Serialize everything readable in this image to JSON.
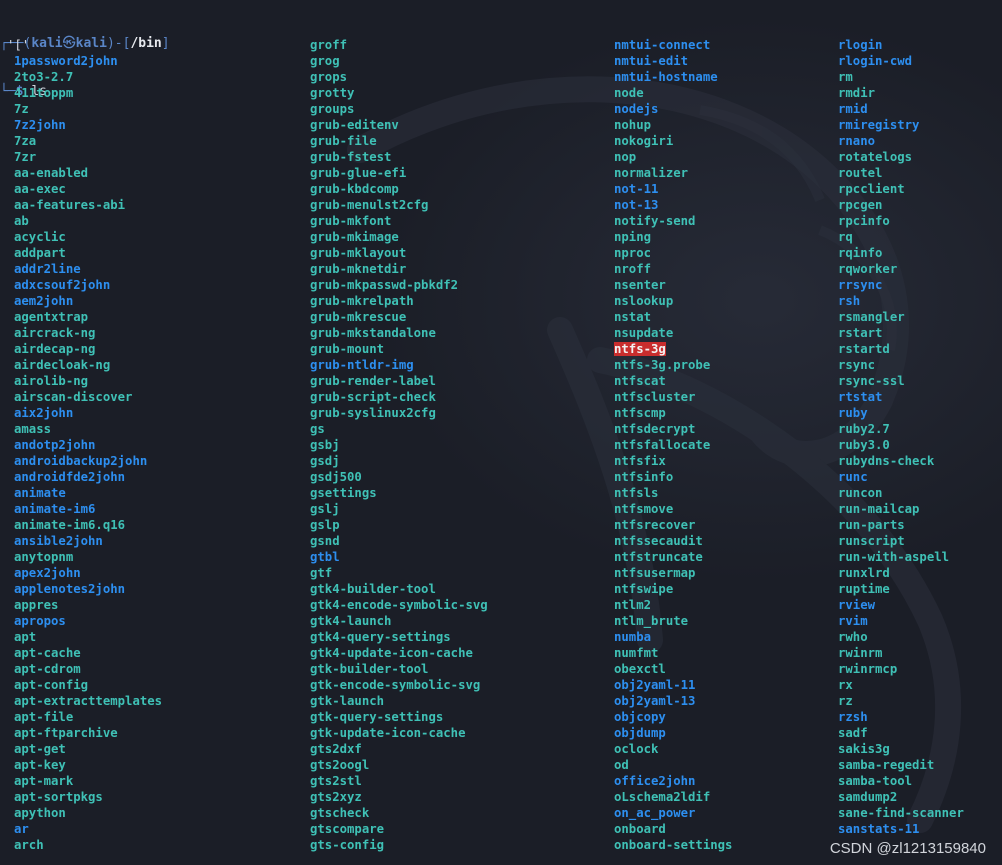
{
  "prompt": {
    "line1_open": "┌──(",
    "user": "kali",
    "at": "㉿",
    "host": "kali",
    "mid": ")-[",
    "cwd": "/bin",
    "close": "]",
    "line2_prefix": "└─",
    "dollar": "$",
    "command": "ls"
  },
  "colors": {
    "background": "#1b1e27",
    "executable": "#3fc1b6",
    "symlink": "#2d8ff0",
    "plain": "#d8dbe2",
    "highlight_bg": "#c92d2d"
  },
  "columns": [
    [
      {
        "name": "'['",
        "type": "plain"
      },
      {
        "name": "1password2john",
        "type": "link"
      },
      {
        "name": "2to3-2.7",
        "type": "exe"
      },
      {
        "name": "411toppm",
        "type": "exe"
      },
      {
        "name": "7z",
        "type": "exe"
      },
      {
        "name": "7z2john",
        "type": "link"
      },
      {
        "name": "7za",
        "type": "exe"
      },
      {
        "name": "7zr",
        "type": "exe"
      },
      {
        "name": "aa-enabled",
        "type": "exe"
      },
      {
        "name": "aa-exec",
        "type": "exe"
      },
      {
        "name": "aa-features-abi",
        "type": "exe"
      },
      {
        "name": "ab",
        "type": "exe"
      },
      {
        "name": "acyclic",
        "type": "exe"
      },
      {
        "name": "addpart",
        "type": "exe"
      },
      {
        "name": "addr2line",
        "type": "link"
      },
      {
        "name": "adxcsouf2john",
        "type": "link"
      },
      {
        "name": "aem2john",
        "type": "link"
      },
      {
        "name": "agentxtrap",
        "type": "exe"
      },
      {
        "name": "aircrack-ng",
        "type": "exe"
      },
      {
        "name": "airdecap-ng",
        "type": "exe"
      },
      {
        "name": "airdecloak-ng",
        "type": "exe"
      },
      {
        "name": "airolib-ng",
        "type": "exe"
      },
      {
        "name": "airscan-discover",
        "type": "exe"
      },
      {
        "name": "aix2john",
        "type": "link"
      },
      {
        "name": "amass",
        "type": "exe"
      },
      {
        "name": "andotp2john",
        "type": "link"
      },
      {
        "name": "androidbackup2john",
        "type": "link"
      },
      {
        "name": "androidfde2john",
        "type": "link"
      },
      {
        "name": "animate",
        "type": "link"
      },
      {
        "name": "animate-im6",
        "type": "link"
      },
      {
        "name": "animate-im6.q16",
        "type": "exe"
      },
      {
        "name": "ansible2john",
        "type": "link"
      },
      {
        "name": "anytopnm",
        "type": "exe"
      },
      {
        "name": "apex2john",
        "type": "link"
      },
      {
        "name": "applenotes2john",
        "type": "link"
      },
      {
        "name": "appres",
        "type": "exe"
      },
      {
        "name": "apropos",
        "type": "link"
      },
      {
        "name": "apt",
        "type": "exe"
      },
      {
        "name": "apt-cache",
        "type": "exe"
      },
      {
        "name": "apt-cdrom",
        "type": "exe"
      },
      {
        "name": "apt-config",
        "type": "exe"
      },
      {
        "name": "apt-extracttemplates",
        "type": "exe"
      },
      {
        "name": "apt-file",
        "type": "exe"
      },
      {
        "name": "apt-ftparchive",
        "type": "exe"
      },
      {
        "name": "apt-get",
        "type": "exe"
      },
      {
        "name": "apt-key",
        "type": "exe"
      },
      {
        "name": "apt-mark",
        "type": "exe"
      },
      {
        "name": "apt-sortpkgs",
        "type": "exe"
      },
      {
        "name": "apython",
        "type": "exe"
      },
      {
        "name": "ar",
        "type": "link"
      },
      {
        "name": "arch",
        "type": "exe"
      }
    ],
    [
      {
        "name": "groff",
        "type": "exe"
      },
      {
        "name": "grog",
        "type": "exe"
      },
      {
        "name": "grops",
        "type": "exe"
      },
      {
        "name": "grotty",
        "type": "exe"
      },
      {
        "name": "groups",
        "type": "exe"
      },
      {
        "name": "grub-editenv",
        "type": "exe"
      },
      {
        "name": "grub-file",
        "type": "exe"
      },
      {
        "name": "grub-fstest",
        "type": "exe"
      },
      {
        "name": "grub-glue-efi",
        "type": "exe"
      },
      {
        "name": "grub-kbdcomp",
        "type": "exe"
      },
      {
        "name": "grub-menulst2cfg",
        "type": "exe"
      },
      {
        "name": "grub-mkfont",
        "type": "exe"
      },
      {
        "name": "grub-mkimage",
        "type": "exe"
      },
      {
        "name": "grub-mklayout",
        "type": "exe"
      },
      {
        "name": "grub-mknetdir",
        "type": "exe"
      },
      {
        "name": "grub-mkpasswd-pbkdf2",
        "type": "exe"
      },
      {
        "name": "grub-mkrelpath",
        "type": "exe"
      },
      {
        "name": "grub-mkrescue",
        "type": "exe"
      },
      {
        "name": "grub-mkstandalone",
        "type": "exe"
      },
      {
        "name": "grub-mount",
        "type": "exe"
      },
      {
        "name": "grub-ntldr-img",
        "type": "link"
      },
      {
        "name": "grub-render-label",
        "type": "exe"
      },
      {
        "name": "grub-script-check",
        "type": "exe"
      },
      {
        "name": "grub-syslinux2cfg",
        "type": "exe"
      },
      {
        "name": "gs",
        "type": "exe"
      },
      {
        "name": "gsbj",
        "type": "exe"
      },
      {
        "name": "gsdj",
        "type": "exe"
      },
      {
        "name": "gsdj500",
        "type": "exe"
      },
      {
        "name": "gsettings",
        "type": "exe"
      },
      {
        "name": "gslj",
        "type": "exe"
      },
      {
        "name": "gslp",
        "type": "exe"
      },
      {
        "name": "gsnd",
        "type": "exe"
      },
      {
        "name": "gtbl",
        "type": "link"
      },
      {
        "name": "gtf",
        "type": "exe"
      },
      {
        "name": "gtk4-builder-tool",
        "type": "exe"
      },
      {
        "name": "gtk4-encode-symbolic-svg",
        "type": "exe"
      },
      {
        "name": "gtk4-launch",
        "type": "exe"
      },
      {
        "name": "gtk4-query-settings",
        "type": "exe"
      },
      {
        "name": "gtk4-update-icon-cache",
        "type": "exe"
      },
      {
        "name": "gtk-builder-tool",
        "type": "exe"
      },
      {
        "name": "gtk-encode-symbolic-svg",
        "type": "exe"
      },
      {
        "name": "gtk-launch",
        "type": "exe"
      },
      {
        "name": "gtk-query-settings",
        "type": "exe"
      },
      {
        "name": "gtk-update-icon-cache",
        "type": "exe"
      },
      {
        "name": "gts2dxf",
        "type": "exe"
      },
      {
        "name": "gts2oogl",
        "type": "exe"
      },
      {
        "name": "gts2stl",
        "type": "exe"
      },
      {
        "name": "gts2xyz",
        "type": "exe"
      },
      {
        "name": "gtscheck",
        "type": "exe"
      },
      {
        "name": "gtscompare",
        "type": "exe"
      },
      {
        "name": "gts-config",
        "type": "exe"
      }
    ],
    [
      {
        "name": "nmtui-connect",
        "type": "link"
      },
      {
        "name": "nmtui-edit",
        "type": "link"
      },
      {
        "name": "nmtui-hostname",
        "type": "link"
      },
      {
        "name": "node",
        "type": "exe"
      },
      {
        "name": "nodejs",
        "type": "link"
      },
      {
        "name": "nohup",
        "type": "exe"
      },
      {
        "name": "nokogiri",
        "type": "exe"
      },
      {
        "name": "nop",
        "type": "exe"
      },
      {
        "name": "normalizer",
        "type": "exe"
      },
      {
        "name": "not-11",
        "type": "link"
      },
      {
        "name": "not-13",
        "type": "link"
      },
      {
        "name": "notify-send",
        "type": "exe"
      },
      {
        "name": "nping",
        "type": "exe"
      },
      {
        "name": "nproc",
        "type": "exe"
      },
      {
        "name": "nroff",
        "type": "exe"
      },
      {
        "name": "nsenter",
        "type": "exe"
      },
      {
        "name": "nslookup",
        "type": "exe"
      },
      {
        "name": "nstat",
        "type": "exe"
      },
      {
        "name": "nsupdate",
        "type": "exe"
      },
      {
        "name": "ntfs-3g",
        "type": "hl"
      },
      {
        "name": "ntfs-3g.probe",
        "type": "exe"
      },
      {
        "name": "ntfscat",
        "type": "exe"
      },
      {
        "name": "ntfscluster",
        "type": "exe"
      },
      {
        "name": "ntfscmp",
        "type": "exe"
      },
      {
        "name": "ntfsdecrypt",
        "type": "exe"
      },
      {
        "name": "ntfsfallocate",
        "type": "exe"
      },
      {
        "name": "ntfsfix",
        "type": "exe"
      },
      {
        "name": "ntfsinfo",
        "type": "exe"
      },
      {
        "name": "ntfsls",
        "type": "exe"
      },
      {
        "name": "ntfsmove",
        "type": "exe"
      },
      {
        "name": "ntfsrecover",
        "type": "exe"
      },
      {
        "name": "ntfssecaudit",
        "type": "exe"
      },
      {
        "name": "ntfstruncate",
        "type": "exe"
      },
      {
        "name": "ntfsusermap",
        "type": "exe"
      },
      {
        "name": "ntfswipe",
        "type": "exe"
      },
      {
        "name": "ntlm2",
        "type": "exe"
      },
      {
        "name": "ntlm_brute",
        "type": "exe"
      },
      {
        "name": "numba",
        "type": "link"
      },
      {
        "name": "numfmt",
        "type": "exe"
      },
      {
        "name": "obexctl",
        "type": "exe"
      },
      {
        "name": "obj2yaml-11",
        "type": "link"
      },
      {
        "name": "obj2yaml-13",
        "type": "link"
      },
      {
        "name": "objcopy",
        "type": "link"
      },
      {
        "name": "objdump",
        "type": "link"
      },
      {
        "name": "oclock",
        "type": "exe"
      },
      {
        "name": "od",
        "type": "exe"
      },
      {
        "name": "office2john",
        "type": "link"
      },
      {
        "name": "oLschema2ldif",
        "type": "exe"
      },
      {
        "name": "on_ac_power",
        "type": "link"
      },
      {
        "name": "onboard",
        "type": "exe"
      },
      {
        "name": "onboard-settings",
        "type": "exe"
      }
    ],
    [
      {
        "name": "rlogin",
        "type": "link"
      },
      {
        "name": "rlogin-cwd",
        "type": "link"
      },
      {
        "name": "rm",
        "type": "exe"
      },
      {
        "name": "rmdir",
        "type": "exe"
      },
      {
        "name": "rmid",
        "type": "link"
      },
      {
        "name": "rmiregistry",
        "type": "link"
      },
      {
        "name": "rnano",
        "type": "link"
      },
      {
        "name": "rotatelogs",
        "type": "exe"
      },
      {
        "name": "routel",
        "type": "exe"
      },
      {
        "name": "rpcclient",
        "type": "exe"
      },
      {
        "name": "rpcgen",
        "type": "exe"
      },
      {
        "name": "rpcinfo",
        "type": "exe"
      },
      {
        "name": "rq",
        "type": "exe"
      },
      {
        "name": "rqinfo",
        "type": "exe"
      },
      {
        "name": "rqworker",
        "type": "exe"
      },
      {
        "name": "rrsync",
        "type": "link"
      },
      {
        "name": "rsh",
        "type": "link"
      },
      {
        "name": "rsmangler",
        "type": "exe"
      },
      {
        "name": "rstart",
        "type": "exe"
      },
      {
        "name": "rstartd",
        "type": "exe"
      },
      {
        "name": "rsync",
        "type": "exe"
      },
      {
        "name": "rsync-ssl",
        "type": "exe"
      },
      {
        "name": "rtstat",
        "type": "link"
      },
      {
        "name": "ruby",
        "type": "link"
      },
      {
        "name": "ruby2.7",
        "type": "exe"
      },
      {
        "name": "ruby3.0",
        "type": "exe"
      },
      {
        "name": "rubydns-check",
        "type": "exe"
      },
      {
        "name": "runc",
        "type": "link"
      },
      {
        "name": "runcon",
        "type": "exe"
      },
      {
        "name": "run-mailcap",
        "type": "exe"
      },
      {
        "name": "run-parts",
        "type": "exe"
      },
      {
        "name": "runscript",
        "type": "exe"
      },
      {
        "name": "run-with-aspell",
        "type": "exe"
      },
      {
        "name": "runxlrd",
        "type": "exe"
      },
      {
        "name": "ruptime",
        "type": "exe"
      },
      {
        "name": "rview",
        "type": "link"
      },
      {
        "name": "rvim",
        "type": "link"
      },
      {
        "name": "rwho",
        "type": "exe"
      },
      {
        "name": "rwinrm",
        "type": "exe"
      },
      {
        "name": "rwinrmcp",
        "type": "exe"
      },
      {
        "name": "rx",
        "type": "exe"
      },
      {
        "name": "rz",
        "type": "exe"
      },
      {
        "name": "rzsh",
        "type": "link"
      },
      {
        "name": "sadf",
        "type": "exe"
      },
      {
        "name": "sakis3g",
        "type": "exe"
      },
      {
        "name": "samba-regedit",
        "type": "exe"
      },
      {
        "name": "samba-tool",
        "type": "exe"
      },
      {
        "name": "samdump2",
        "type": "exe"
      },
      {
        "name": "sane-find-scanner",
        "type": "exe"
      },
      {
        "name": "sanstats-11",
        "type": "link"
      },
      {
        "name": "",
        "type": "exe"
      }
    ]
  ],
  "watermark": "CSDN @zl1213159840"
}
